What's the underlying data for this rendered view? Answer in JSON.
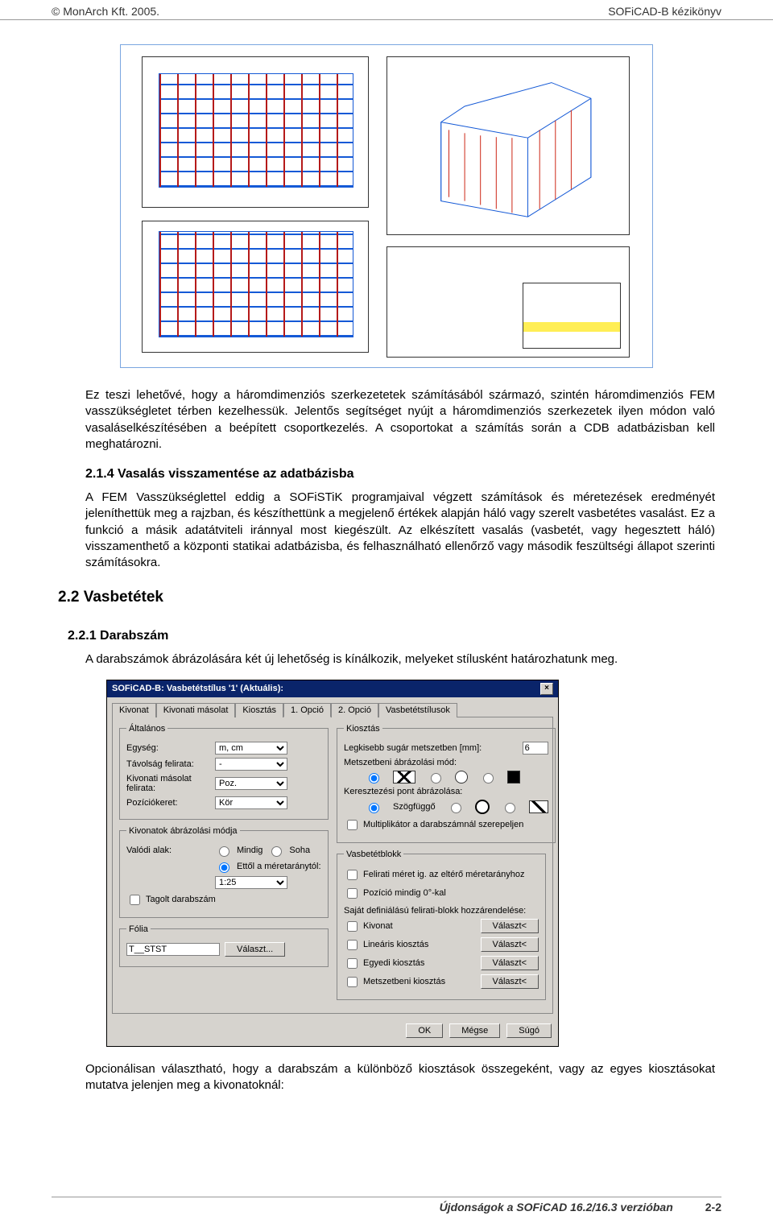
{
  "header": {
    "left": "© MonArch Kft. 2005.",
    "right": "SOFiCAD-B kézikönyv"
  },
  "para1": "Ez teszi lehetővé, hogy a háromdimenziós szerkezetetek számításából származó, szintén háromdimenziós FEM vasszükségletet térben kezelhessük. Jelentős segítséget nyújt a háromdimenziós szerkezetek ilyen módon való vasaláselkészítésében a beépített csoportkezelés. A csoportokat a számítás során a CDB adatbázisban kell meghatározni.",
  "h3_214": "2.1.4 Vasalás visszamentése az adatbázisba",
  "para2": "A FEM Vasszükséglettel eddig a SOFiSTiK programjaival végzett számítások és méretezések eredményét jeleníthettük meg a rajzban, és készíthettünk a megjelenő értékek alapján háló vagy szerelt vasbetétes vasalást. Ez a funkció a másik adatátviteli iránnyal most kiegészült. Az elkészített vasalás (vasbetét, vagy hegesztett háló) visszamenthető a központi statikai adatbázisba, és felhasználható ellenőrző vagy második feszültségi állapot szerinti számításokra.",
  "h2_22": "2.2 Vasbetétek",
  "h4_221": "2.2.1 Darabszám",
  "para3": "A darabszámok ábrázolására két új lehetőség is kínálkozik, melyeket stílusként határozhatunk meg.",
  "dialog": {
    "title": "SOFiCAD-B: Vasbetétstílus '1' (Aktuális):",
    "tabs": [
      "Kivonat",
      "Kivonati másolat",
      "Kiosztás",
      "1. Opció",
      "2. Opció",
      "Vasbetétstílusok"
    ],
    "activeTab": "1. Opció",
    "general": {
      "legend": "Általános",
      "unit_label": "Egység:",
      "unit_value": "m, cm",
      "dist_label": "Távolság felirata:",
      "dist_value": "-",
      "copy_label": "Kivonati másolat felirata:",
      "copy_value": "Poz.",
      "frame_label": "Pozíciókeret:",
      "frame_value": "Kör"
    },
    "extractmode": {
      "legend": "Kivonatok ábrázolási módja",
      "real_label": "Valódi alak:",
      "opt_always": "Mindig",
      "opt_never": "Soha",
      "opt_scale": "Ettől a méretaránytól:",
      "scale_value": "1:25",
      "split": "Tagolt darabszám"
    },
    "folia": {
      "legend": "Fólia",
      "value": "T__STST",
      "btn": "Választ..."
    },
    "kiosztas": {
      "legend": "Kiosztás",
      "minrad_label": "Legkisebb sugár metszetben [mm]:",
      "minrad_value": "6",
      "sectmode_label": "Metszetbeni ábrázolási mód:",
      "cross_label": "Keresztezési pont ábrázolása:",
      "angle_label": "Szögfüggő",
      "mult_label": "Multiplikátor a darabszámnál szerepeljen"
    },
    "block": {
      "legend": "Vasbetétblokk",
      "cap_size": "Felirati méret ig. az eltérő méretarányhoz",
      "pos_zero": "Pozíció mindig 0°-kal",
      "assign": "Saját definiálású felirati-blokk hozzárendelése:",
      "items": [
        "Kivonat",
        "Lineáris kiosztás",
        "Egyedi kiosztás",
        "Metszetbeni kiosztás"
      ],
      "select": "Választ<"
    },
    "buttons": {
      "ok": "OK",
      "cancel": "Mégse",
      "help": "Súgó"
    }
  },
  "para4": "Opcionálisan választható, hogy a darabszám a különböző kiosztások összegeként, vagy az egyes kiosztásokat mutatva jelenjen meg a kivonatoknál:",
  "footer": {
    "text": "Újdonságok a SOFiCAD 16.2/16.3 verzióban",
    "page": "2-2"
  }
}
